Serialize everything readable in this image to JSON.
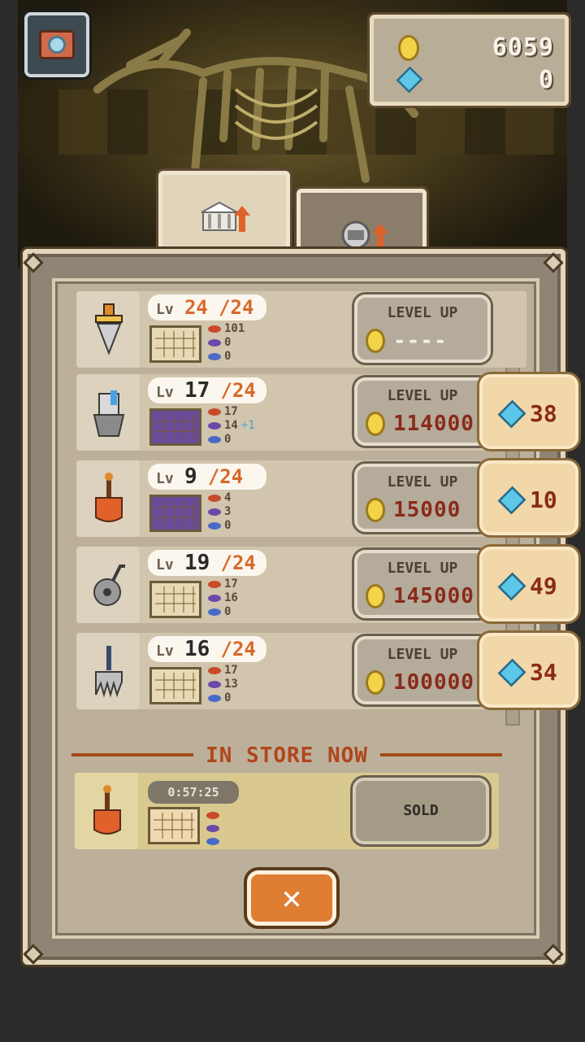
{
  "currency": {
    "gold": "6059",
    "gems": "0"
  },
  "tabs": [
    {
      "name": "museum-upgrade",
      "icon": "museum-upgrade-icon",
      "active": true
    },
    {
      "name": "tool-upgrade",
      "icon": "tool-upgrade-icon",
      "active": false
    }
  ],
  "tools": [
    {
      "icon": "drill-icon",
      "level": "24",
      "max": "/24",
      "lv_label": "Lv",
      "stats": [
        "101",
        "0",
        "0"
      ],
      "bonus": "",
      "level_up_label": "LEVEL UP",
      "cost": "----",
      "gem_cost": ""
    },
    {
      "icon": "robot-drill-icon",
      "level": "17",
      "max": "/24",
      "lv_label": "Lv",
      "stats": [
        "17",
        "14",
        "0"
      ],
      "bonus": "+1",
      "level_up_label": "LEVEL UP",
      "cost": "114000",
      "gem_cost": "38"
    },
    {
      "icon": "shovel-icon",
      "level": "9",
      "max": "/24",
      "lv_label": "Lv",
      "stats": [
        "4",
        "3",
        "0"
      ],
      "bonus": "",
      "level_up_label": "LEVEL UP",
      "cost": "15000",
      "gem_cost": "10"
    },
    {
      "icon": "saw-icon",
      "level": "19",
      "max": "/24",
      "lv_label": "Lv",
      "stats": [
        "17",
        "16",
        "0"
      ],
      "bonus": "",
      "level_up_label": "LEVEL UP",
      "cost": "145000",
      "gem_cost": "49"
    },
    {
      "icon": "claw-icon",
      "level": "16",
      "max": "/24",
      "lv_label": "Lv",
      "stats": [
        "17",
        "13",
        "0"
      ],
      "bonus": "",
      "level_up_label": "LEVEL UP",
      "cost": "100000",
      "gem_cost": "34"
    }
  ],
  "store": {
    "title": "IN STORE NOW",
    "timer": "0:57:25",
    "item_icon": "shovel-icon",
    "sold_label": "SOLD"
  },
  "close_label": "✕",
  "colors": {
    "accent": "#df7d33",
    "red_cost": "#8a2a1a",
    "max_level": "#d7692a"
  }
}
